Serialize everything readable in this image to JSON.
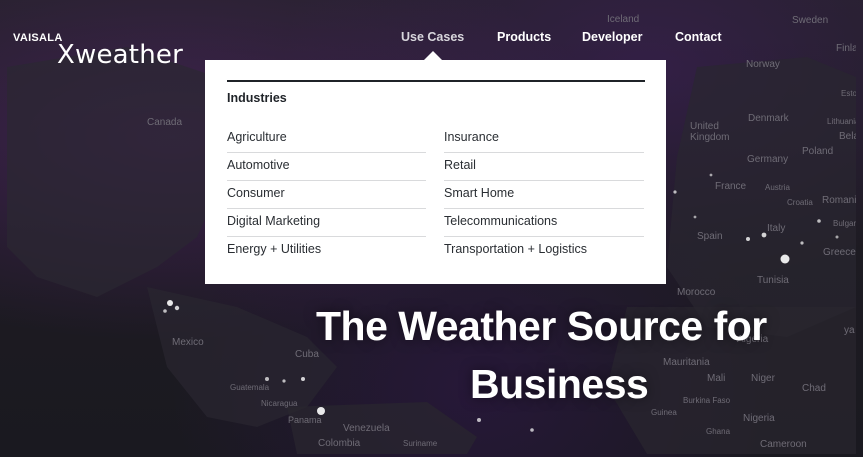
{
  "logo": {
    "brand": "VAISALA",
    "product": "Xweather"
  },
  "nav": [
    {
      "label": "Use Cases",
      "active": true
    },
    {
      "label": "Products",
      "active": false
    },
    {
      "label": "Developer",
      "active": false
    },
    {
      "label": "Contact",
      "active": false
    }
  ],
  "dropdown": {
    "heading": "Industries",
    "left_items": [
      "Agriculture",
      "Automotive",
      "Consumer",
      "Digital Marketing",
      "Energy + Utilities"
    ],
    "right_items": [
      "Insurance",
      "Retail",
      "Smart Home",
      "Telecommunications",
      "Transportation + Logistics"
    ]
  },
  "hero": {
    "line1": "The Weather Source for",
    "line2": "Business"
  },
  "map_labels": [
    "Iceland",
    "Sweden",
    "Finla",
    "Norway",
    "Estoni",
    "Denmark",
    "Lithuania",
    "Bela",
    "United Kingdom",
    "Poland",
    "Germany",
    "France",
    "Austria",
    "Croatia",
    "Romani",
    "Italy",
    "Bulgari",
    "Spain",
    "Greece",
    "Tunisia",
    "Morocco",
    "Algeria",
    "ya",
    "Mauritania",
    "Mali",
    "Niger",
    "Chad",
    "Burkina Faso",
    "Guinea",
    "Ghana",
    "Nigeria",
    "Cameroon",
    "Canada",
    "Mexico",
    "Cuba",
    "Guatemala",
    "Nicaragua",
    "Panama",
    "Venezuela",
    "Colombia",
    "Suriname"
  ],
  "colors": {
    "map_bg": "#1d1b22",
    "accent_purple": "#7a3aa8",
    "menu_rule": "#1f2328"
  }
}
